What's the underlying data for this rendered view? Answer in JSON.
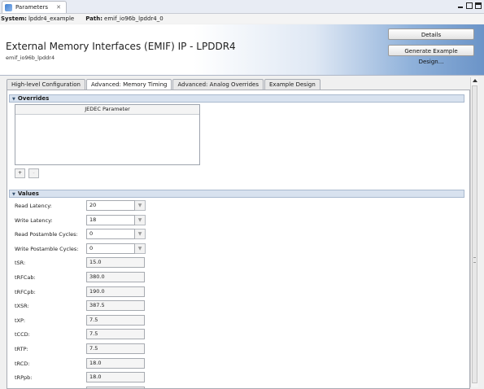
{
  "view_tab": {
    "label": "Parameters",
    "close": "✕"
  },
  "path_bar": {
    "system_label": "System:",
    "system_value": "lpddr4_example",
    "path_label": "Path:",
    "path_value": "emif_io96b_lpddr4_0"
  },
  "header": {
    "title": "External Memory Interfaces (EMIF) IP - LPDDR4",
    "subtitle": "emif_io96b_lpddr4",
    "details_button": "Details",
    "generate_button": "Generate Example Design..."
  },
  "tabs": [
    {
      "label": "High-level Configuration",
      "active": false
    },
    {
      "label": "Advanced: Memory Timing",
      "active": true
    },
    {
      "label": "Advanced: Analog Overrides",
      "active": false
    },
    {
      "label": "Example Design",
      "active": false
    }
  ],
  "overrides": {
    "section_label": "Overrides",
    "table_header": "JEDEC Parameter",
    "add_label": "+",
    "remove_label": "-"
  },
  "values": {
    "section_label": "Values",
    "rows": [
      {
        "label": "Read Latency:",
        "value": "20",
        "type": "combo"
      },
      {
        "label": "Write Latency:",
        "value": "18",
        "type": "combo"
      },
      {
        "label": "Read Postamble Cycles:",
        "value": "0",
        "type": "combo"
      },
      {
        "label": "Write Postamble Cycles:",
        "value": "0",
        "type": "combo"
      },
      {
        "label": "tSR:",
        "value": "15.0",
        "type": "text"
      },
      {
        "label": "tRFCab:",
        "value": "380.0",
        "type": "text"
      },
      {
        "label": "tRFCpb:",
        "value": "190.0",
        "type": "text"
      },
      {
        "label": "tXSR:",
        "value": "387.5",
        "type": "text"
      },
      {
        "label": "tXP:",
        "value": "7.5",
        "type": "text"
      },
      {
        "label": "tCCD:",
        "value": "7.5",
        "type": "text"
      },
      {
        "label": "tRTP:",
        "value": "7.5",
        "type": "text"
      },
      {
        "label": "tRCD:",
        "value": "18.0",
        "type": "text"
      },
      {
        "label": "tRPpb:",
        "value": "18.0",
        "type": "text"
      },
      {
        "label": "",
        "value": "",
        "type": "text"
      }
    ]
  },
  "icons": {
    "app": "parameters-icon",
    "section_toggle": "chevron-down-icon",
    "combo_arrow": "chevron-down-icon",
    "win_min": "minimize-icon",
    "win_restore": "restore-icon",
    "win_max": "maximize-icon"
  },
  "colors": {
    "header_gradient_end": "#6b94c8",
    "section_bg": "#d8e2ef",
    "active_tab": "#ffffff"
  }
}
